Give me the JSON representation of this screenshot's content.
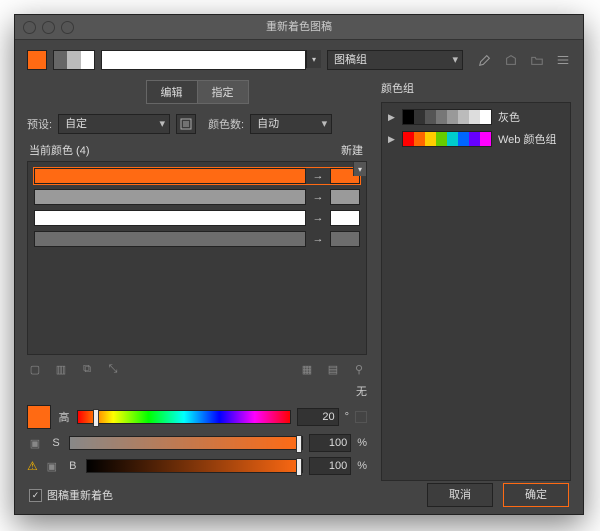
{
  "title": "重新着色图稿",
  "topbar": {
    "group_select": "图稿组"
  },
  "tabs": {
    "edit": "编辑",
    "assign": "指定"
  },
  "preset": {
    "label": "预设:",
    "value": "自定",
    "count_label": "颜色数:",
    "count_value": "自动"
  },
  "current": {
    "label": "当前颜色 (4)",
    "new_label": "新建",
    "rows": [
      {
        "src": "#ff6a13",
        "dst": "#ff6a13",
        "selected": true
      },
      {
        "src": "#9a9a9a",
        "dst": "#9a9a9a",
        "selected": false
      },
      {
        "src": "#ffffff",
        "dst": "#ffffff",
        "selected": false
      },
      {
        "src": "#6d6d6d",
        "dst": "#6d6d6d",
        "selected": false
      }
    ]
  },
  "none_label": "无",
  "hsb": {
    "h_label": "高",
    "h_value": "20",
    "h_unit": "°",
    "s_label": "S",
    "s_value": "100",
    "s_unit": "%",
    "b_label": "B",
    "b_value": "100",
    "b_unit": "%"
  },
  "right": {
    "header": "颜色组",
    "groups": [
      {
        "name": "灰色",
        "colors": [
          "#000",
          "#333",
          "#555",
          "#777",
          "#999",
          "#bbb",
          "#ddd",
          "#fff"
        ]
      },
      {
        "name": "Web 颜色组",
        "colors": [
          "#f00",
          "#f60",
          "#fc0",
          "#6c0",
          "#0cc",
          "#06f",
          "#60f",
          "#f0f"
        ]
      }
    ]
  },
  "footer": {
    "checkbox_label": "图稿重新着色",
    "cancel": "取消",
    "ok": "确定"
  }
}
